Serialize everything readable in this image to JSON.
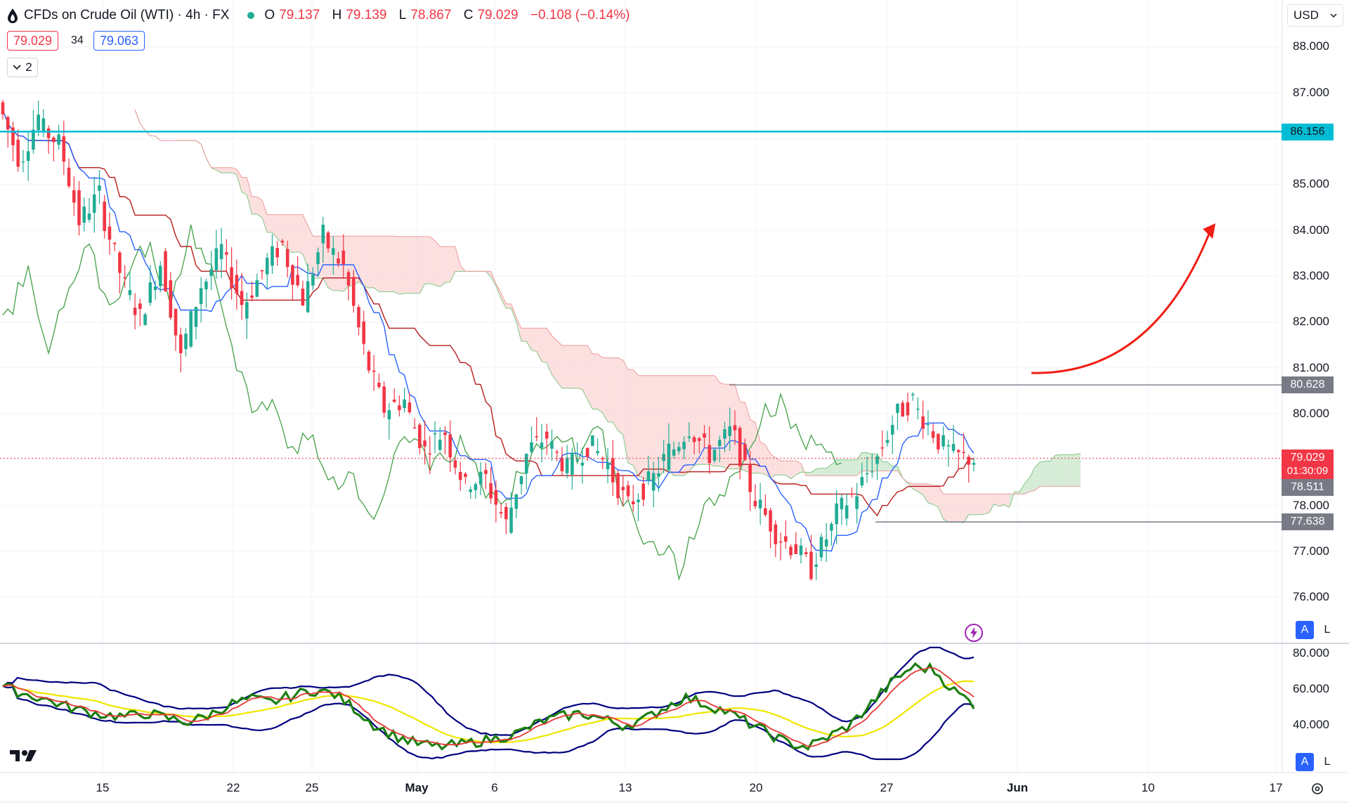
{
  "header": {
    "title": "CFDs on Crude Oil (WTI) · 4h · FX",
    "ohlc": [
      {
        "label": "O",
        "value": "79.137"
      },
      {
        "label": "H",
        "value": "79.139"
      },
      {
        "label": "L",
        "value": "78.867"
      },
      {
        "label": "C",
        "value": "79.029"
      },
      {
        "label": "",
        "value": "−0.108 (−0.14%)"
      }
    ],
    "sell_price": "79.029",
    "spread": "34",
    "buy_price": "79.063",
    "indicator_count": "2"
  },
  "currency_selector": {
    "value": "USD"
  },
  "price_axis": {
    "labels": [
      "88.000",
      "87.000",
      "85.000",
      "84.000",
      "83.000",
      "82.000",
      "81.000",
      "80.000",
      "78.000",
      "77.000",
      "76.000"
    ],
    "tags": {
      "resistance_top": "86.156",
      "resistance_mid": "80.628",
      "last_price": "79.029",
      "countdown": "01:30:09",
      "kijun": "78.511",
      "support": "77.638"
    }
  },
  "oscillator_axis": {
    "labels": [
      "80.000",
      "60.000",
      "40.000"
    ]
  },
  "time_axis": {
    "labels": [
      "15",
      "22",
      "25",
      "May",
      "6",
      "13",
      "20",
      "27",
      "Jun",
      "10",
      "17"
    ]
  },
  "scale_buttons": {
    "auto": "A",
    "log": "L"
  },
  "colors": {
    "bull": "#22ab94",
    "bear": "#f23645",
    "tenkan": "#2962ff",
    "kijun": "#b71c1c",
    "chikou": "#43a047",
    "cloud_bull": "#c8e6c9",
    "cloud_bear": "#fbd5d5",
    "resistance_line": "#00bcd4",
    "rsi": "#1b7f10",
    "rsi_ma": "#e53935",
    "bb_band": "#000080",
    "bb_mid": "#f0e600"
  },
  "chart_data": {
    "type": "candlestick",
    "symbol": "CFDs on Crude Oil (WTI)",
    "timeframe": "4h",
    "indicators": [
      "Ichimoku Cloud",
      "RSI with Bollinger Bands"
    ],
    "price_ylim": [
      75.5,
      88.5
    ],
    "oscillator_ylim": [
      20,
      85
    ],
    "horizontal_levels": [
      86.156,
      80.628,
      77.638
    ],
    "last_price": 79.029,
    "price_path": [
      [
        86.8,
        85.6
      ],
      [
        85.4,
        86.5
      ],
      [
        86.3,
        85.9
      ],
      [
        86.0,
        84.2
      ],
      [
        84.2,
        84.8
      ],
      [
        84.6,
        83.1
      ],
      [
        83.0,
        82.1
      ],
      [
        82.1,
        83.3
      ],
      [
        83.4,
        81.2
      ],
      [
        81.3,
        82.8
      ],
      [
        82.7,
        83.6
      ],
      [
        83.5,
        82.4
      ],
      [
        82.3,
        83.1
      ],
      [
        83.2,
        83.7
      ],
      [
        83.6,
        82.5
      ],
      [
        82.4,
        83.9
      ],
      [
        83.8,
        83.2
      ],
      [
        83.2,
        81.4
      ],
      [
        81.3,
        80.1
      ],
      [
        80.1,
        80.3
      ],
      [
        80.2,
        79.2
      ],
      [
        79.3,
        79.6
      ],
      [
        79.5,
        78.4
      ],
      [
        78.5,
        78.6
      ],
      [
        78.5,
        77.6
      ],
      [
        77.6,
        79.1
      ],
      [
        79.2,
        79.5
      ],
      [
        79.4,
        78.8
      ],
      [
        78.8,
        79.3
      ],
      [
        79.4,
        78.9
      ],
      [
        78.8,
        78.0
      ],
      [
        78.0,
        78.5
      ],
      [
        78.4,
        79.2
      ],
      [
        79.1,
        79.7
      ],
      [
        79.7,
        79.1
      ],
      [
        79.1,
        79.6
      ],
      [
        79.8,
        78.4
      ],
      [
        78.3,
        77.6
      ],
      [
        77.5,
        77.1
      ],
      [
        77.2,
        76.6
      ],
      [
        76.7,
        77.5
      ],
      [
        77.7,
        78.2
      ],
      [
        78.1,
        78.9
      ],
      [
        78.8,
        79.8
      ],
      [
        79.9,
        80.3
      ],
      [
        80.2,
        79.6
      ],
      [
        79.5,
        79.1
      ],
      [
        79.1,
        79.0
      ]
    ],
    "rsi": [
      62,
      58,
      55,
      51,
      48,
      46,
      45,
      47,
      44,
      42,
      46,
      52,
      55,
      53,
      57,
      60,
      58,
      50,
      40,
      34,
      30,
      28,
      29,
      31,
      33,
      36,
      42,
      45,
      47,
      44,
      40,
      43,
      50,
      56,
      52,
      48,
      42,
      36,
      30,
      28,
      34,
      40,
      52,
      64,
      73,
      72,
      60,
      52
    ]
  }
}
